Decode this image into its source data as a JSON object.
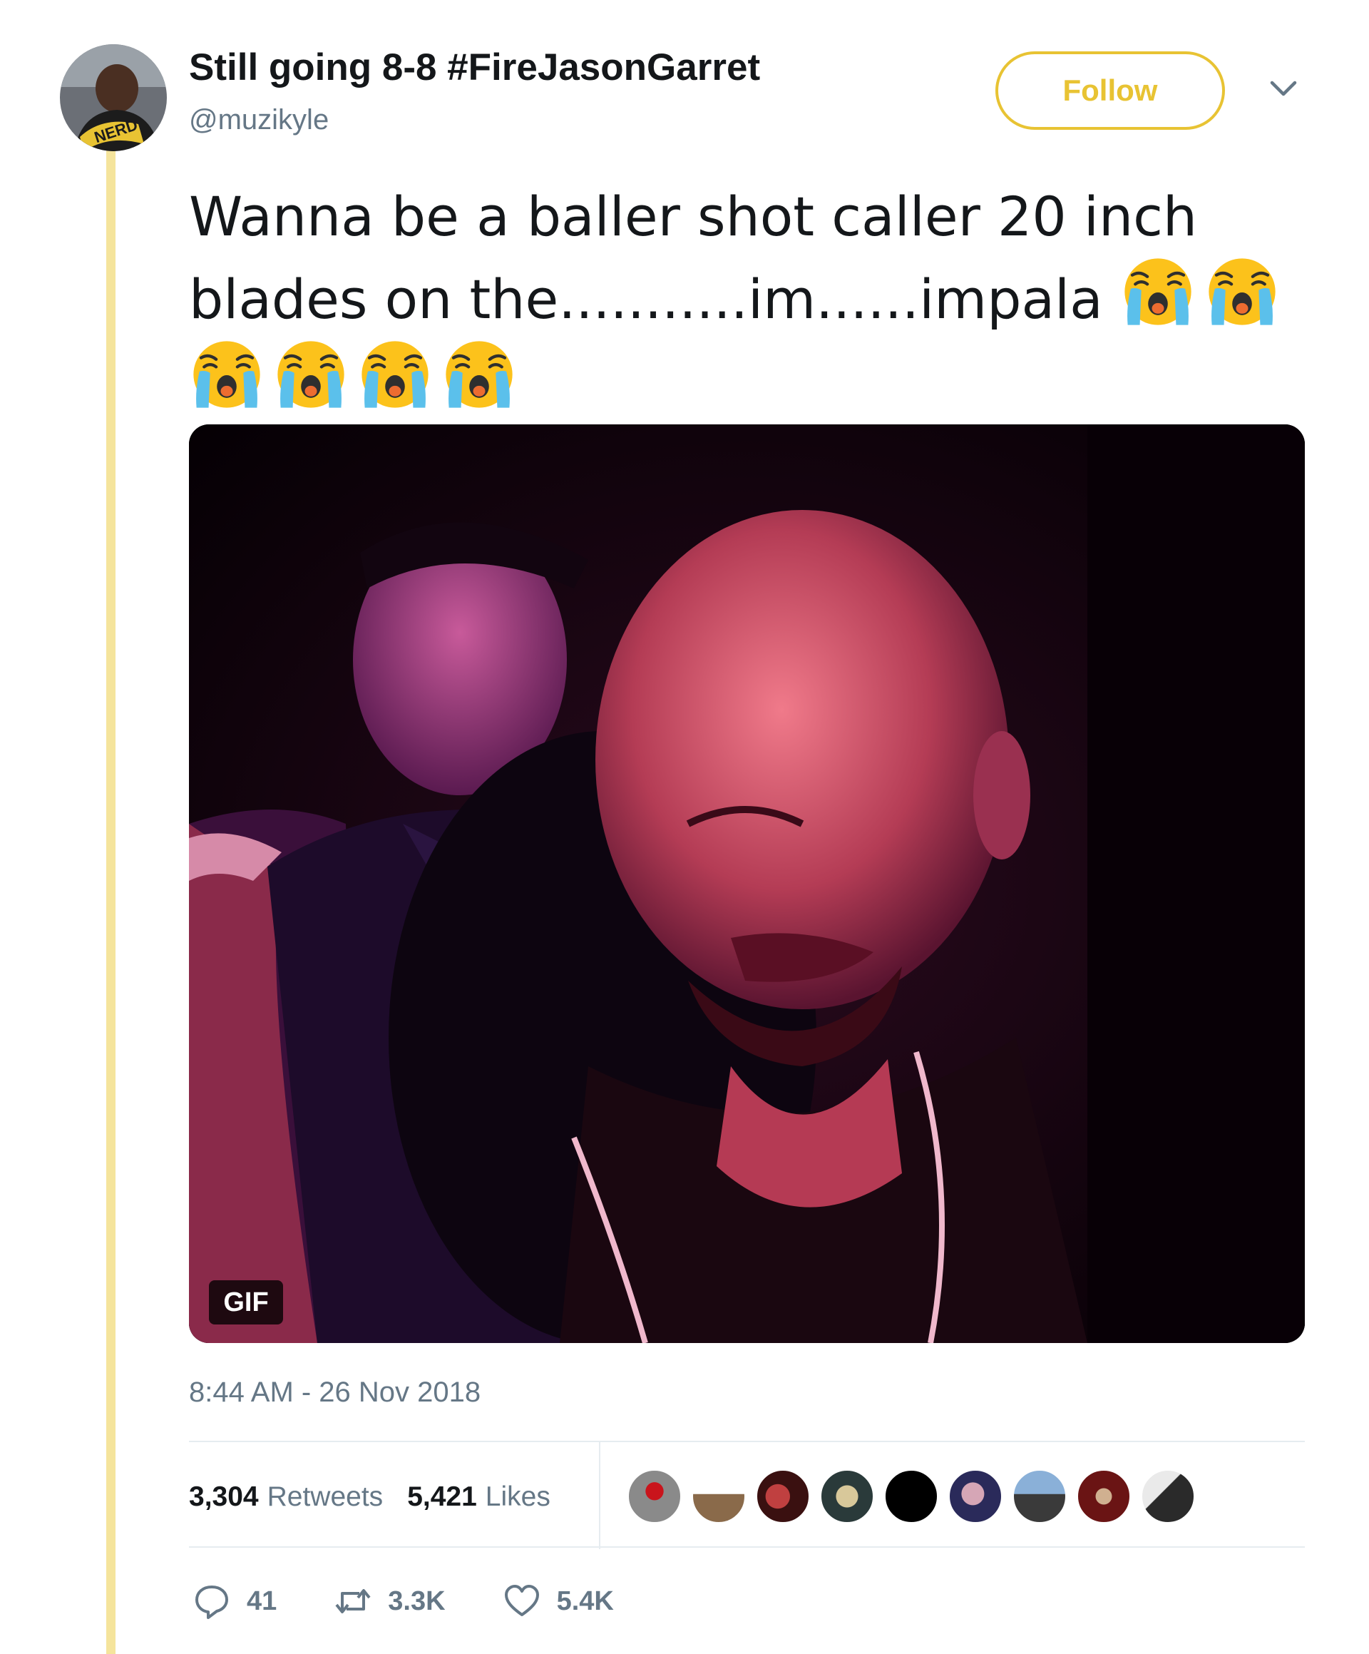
{
  "author": {
    "display_name": "Still going 8-8 #FireJasonGarret",
    "handle": "@muzikyle",
    "avatar_icon": "user-avatar"
  },
  "header": {
    "follow_label": "Follow",
    "accent_color": "#e8c333",
    "menu_icon": "chevron-down-icon"
  },
  "tweet": {
    "text": "Wanna be a baller shot caller 20 inch blades on the...........im......impala",
    "emoji": [
      "😭",
      "😭",
      "😭",
      "😭",
      "😭",
      "😭"
    ],
    "media_badge": "GIF",
    "timestamp": "8:44 AM - 26 Nov 2018"
  },
  "stats": {
    "retweets_count": "3,304",
    "retweets_label": "Retweets",
    "likes_count": "5,421",
    "likes_label": "Likes",
    "liker_count_shown": 9
  },
  "actions": {
    "reply_icon": "reply-icon",
    "reply_count": "41",
    "retweet_icon": "retweet-icon",
    "retweet_count": "3.3K",
    "like_icon": "heart-icon",
    "like_count": "5.4K"
  }
}
